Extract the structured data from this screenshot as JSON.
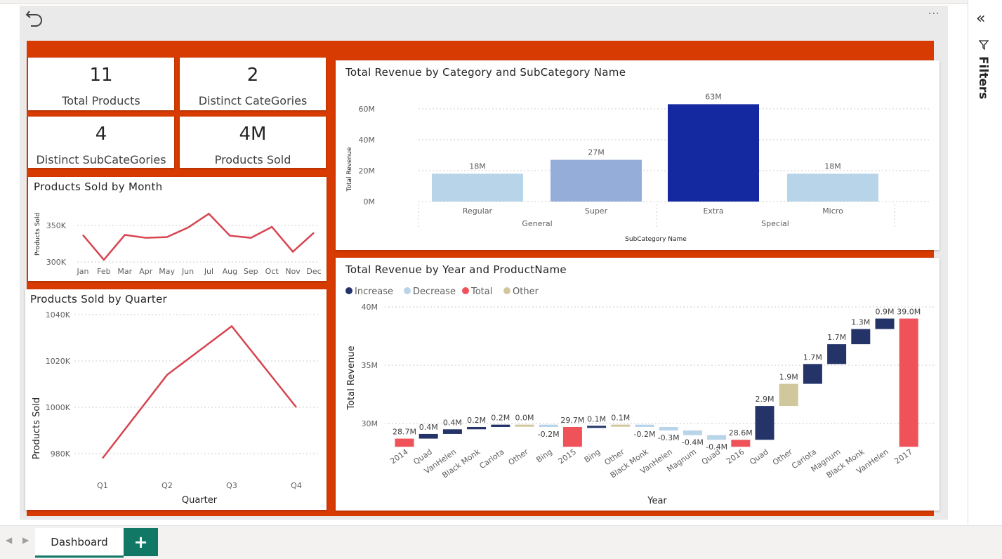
{
  "kpis": [
    {
      "value": "11",
      "label": "Total Products"
    },
    {
      "value": "2",
      "label": "Distinct CateGories"
    },
    {
      "value": "4",
      "label": "Distinct SubCateGories"
    },
    {
      "value": "4M",
      "label": "Products Sold"
    }
  ],
  "month_chart": {
    "title": "Products Sold by Month",
    "ylabel": "Products Sold",
    "yticks": [
      "350K",
      "300K"
    ],
    "categories": [
      "Jan",
      "Feb",
      "Mar",
      "Apr",
      "May",
      "Jun",
      "Jul",
      "Aug",
      "Sep",
      "Oct",
      "Nov",
      "Dec"
    ],
    "values": [
      337,
      303,
      337,
      333,
      334,
      347,
      366,
      336,
      333,
      348,
      314,
      340
    ],
    "color": "#d64550"
  },
  "quarter_chart": {
    "title": "Products Sold by Quarter",
    "ylabel": "Products Sold",
    "xlabel": "Quarter",
    "yticks": [
      "1040K",
      "1020K",
      "1000K",
      "980K"
    ],
    "categories": [
      "Q1",
      "Q2",
      "Q3",
      "Q4"
    ],
    "values": [
      978,
      1014,
      1035,
      1000
    ],
    "color": "#d64550"
  },
  "category_chart": {
    "title": "Total Revenue by Category and SubCategory Name",
    "ylabel": "Total Revenue",
    "xlabel": "SubCategory Name",
    "yticks": [
      "60M",
      "40M",
      "20M",
      "0M"
    ],
    "bars": [
      {
        "label": "Regular",
        "value": 18,
        "data_label": "18M",
        "color": "#b8d4e8"
      },
      {
        "label": "Super",
        "value": 27,
        "data_label": "27M",
        "color": "#94aed9"
      },
      {
        "label": "Extra",
        "value": 63,
        "data_label": "63M",
        "color": "#1428a0"
      },
      {
        "label": "Micro",
        "value": 18,
        "data_label": "18M",
        "color": "#b8d4e8"
      }
    ],
    "groups": [
      "General",
      "Special"
    ]
  },
  "waterfall_chart": {
    "title": "Total Revenue by Year and ProductName",
    "ylabel": "Total Revenue",
    "xlabel": "Year",
    "yticks": [
      "40M",
      "35M",
      "30M"
    ],
    "legend": [
      {
        "label": "Increase",
        "color": "#243469"
      },
      {
        "label": "Decrease",
        "color": "#b8d4e8"
      },
      {
        "label": "Total",
        "color": "#f0525a"
      },
      {
        "label": "Other",
        "color": "#d1c79c"
      }
    ],
    "steps": [
      {
        "label": "2014",
        "type": "total",
        "delta": 28.7,
        "data_label": "28.7M"
      },
      {
        "label": "Quad",
        "type": "inc",
        "delta": 0.4,
        "data_label": "0.4M"
      },
      {
        "label": "VanHelen",
        "type": "inc",
        "delta": 0.4,
        "data_label": "0.4M"
      },
      {
        "label": "Black Monk",
        "type": "inc",
        "delta": 0.2,
        "data_label": "0.2M"
      },
      {
        "label": "Carlota",
        "type": "inc",
        "delta": 0.2,
        "data_label": "0.2M"
      },
      {
        "label": "Other",
        "type": "other",
        "delta": 0.0,
        "data_label": "0.0M"
      },
      {
        "label": "Bing",
        "type": "dec",
        "delta": -0.2,
        "data_label": "-0.2M"
      },
      {
        "label": "2015",
        "type": "total",
        "delta": 29.7,
        "data_label": "29.7M"
      },
      {
        "label": "Bing",
        "type": "inc",
        "delta": 0.1,
        "data_label": "0.1M"
      },
      {
        "label": "Other",
        "type": "other",
        "delta": 0.1,
        "data_label": "0.1M"
      },
      {
        "label": "Black Monk",
        "type": "dec",
        "delta": -0.2,
        "data_label": "-0.2M"
      },
      {
        "label": "VanHelen",
        "type": "dec",
        "delta": -0.3,
        "data_label": "-0.3M"
      },
      {
        "label": "Magnum",
        "type": "dec",
        "delta": -0.4,
        "data_label": "-0.4M"
      },
      {
        "label": "Quad",
        "type": "dec",
        "delta": -0.4,
        "data_label": "-0.4M"
      },
      {
        "label": "2016",
        "type": "total",
        "delta": 28.6,
        "data_label": "28.6M"
      },
      {
        "label": "Quad",
        "type": "inc",
        "delta": 2.9,
        "data_label": "2.9M"
      },
      {
        "label": "Other",
        "type": "other",
        "delta": 1.9,
        "data_label": "1.9M"
      },
      {
        "label": "Carlota",
        "type": "inc",
        "delta": 1.7,
        "data_label": "1.7M"
      },
      {
        "label": "Magnum",
        "type": "inc",
        "delta": 1.7,
        "data_label": "1.7M"
      },
      {
        "label": "Black Monk",
        "type": "inc",
        "delta": 1.3,
        "data_label": "1.3M"
      },
      {
        "label": "VanHelen",
        "type": "inc",
        "delta": 0.9,
        "data_label": "0.9M"
      },
      {
        "label": "2017",
        "type": "total",
        "delta": 39.0,
        "data_label": "39.0M"
      }
    ]
  },
  "chart_data": [
    {
      "type": "line",
      "title": "Products Sold by Month",
      "ylabel": "Products Sold",
      "categories": [
        "Jan",
        "Feb",
        "Mar",
        "Apr",
        "May",
        "Jun",
        "Jul",
        "Aug",
        "Sep",
        "Oct",
        "Nov",
        "Dec"
      ],
      "values": [
        337000,
        303000,
        337000,
        333000,
        334000,
        347000,
        366000,
        336000,
        333000,
        348000,
        314000,
        340000
      ]
    },
    {
      "type": "line",
      "title": "Products Sold by Quarter",
      "xlabel": "Quarter",
      "ylabel": "Products Sold",
      "categories": [
        "Q1",
        "Q2",
        "Q3",
        "Q4"
      ],
      "values": [
        978000,
        1014000,
        1035000,
        1000000
      ]
    },
    {
      "type": "bar",
      "title": "Total Revenue by Category and SubCategory Name",
      "xlabel": "SubCategory Name",
      "ylabel": "Total Revenue",
      "categories": [
        "Regular",
        "Super",
        "Extra",
        "Micro"
      ],
      "groups": [
        "General",
        "General",
        "Special",
        "Special"
      ],
      "values": [
        18000000,
        27000000,
        63000000,
        18000000
      ],
      "ylim": [
        0,
        70000000
      ]
    },
    {
      "type": "bar",
      "title": "Total Revenue by Year and ProductName",
      "xlabel": "Year",
      "ylabel": "Total Revenue",
      "categories": [
        "2014",
        "Quad",
        "VanHelen",
        "Black Monk",
        "Carlota",
        "Other",
        "Bing",
        "2015",
        "Bing",
        "Other",
        "Black Monk",
        "VanHelen",
        "Magnum",
        "Quad",
        "2016",
        "Quad",
        "Other",
        "Carlota",
        "Magnum",
        "Black Monk",
        "VanHelen",
        "2017"
      ],
      "values": [
        28.7,
        0.4,
        0.4,
        0.2,
        0.2,
        0.0,
        -0.2,
        29.7,
        0.1,
        0.1,
        -0.2,
        -0.3,
        -0.4,
        -0.4,
        28.6,
        2.9,
        1.9,
        1.7,
        1.7,
        1.3,
        0.9,
        39.0
      ]
    }
  ],
  "ui": {
    "tab_label": "Dashboard",
    "add_tab": "+",
    "filters_label": "Filters",
    "more_label": "···",
    "collapse_label": "«"
  }
}
